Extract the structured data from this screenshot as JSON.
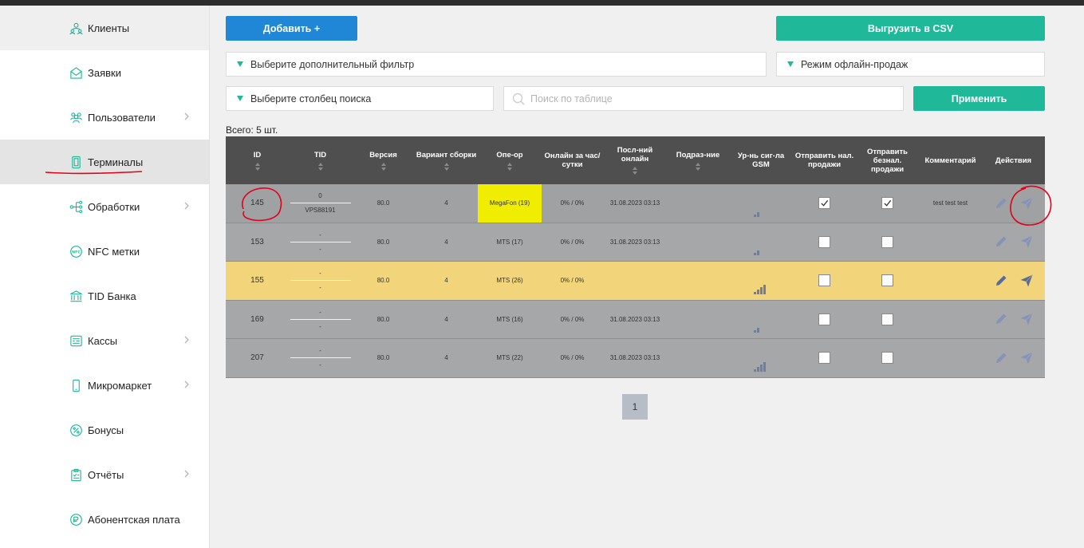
{
  "sidebar": {
    "items": [
      {
        "label": "Клиенты",
        "icon": "users-icon",
        "chevron": false
      },
      {
        "label": "Заявки",
        "icon": "envelope-icon",
        "chevron": false
      },
      {
        "label": "Пользователи",
        "icon": "team-icon",
        "chevron": true
      },
      {
        "label": "Терминалы",
        "icon": "terminal-icon",
        "chevron": false,
        "active": true
      },
      {
        "label": "Обработки",
        "icon": "network-icon",
        "chevron": true
      },
      {
        "label": "NFC метки",
        "icon": "nfc-icon",
        "chevron": false
      },
      {
        "label": "TID Банка",
        "icon": "bank-icon",
        "chevron": false
      },
      {
        "label": "Кассы",
        "icon": "cash-register-icon",
        "chevron": true
      },
      {
        "label": "Микромаркет",
        "icon": "phone-icon",
        "chevron": true
      },
      {
        "label": "Бонусы",
        "icon": "percent-icon",
        "chevron": false
      },
      {
        "label": "Отчёты",
        "icon": "clipboard-icon",
        "chevron": true
      },
      {
        "label": "Абонентская плата",
        "icon": "coins-icon",
        "chevron": false
      }
    ]
  },
  "toolbar": {
    "add_label": "Добавить +",
    "csv_label": "Выгрузить в CSV",
    "filter_placeholder": "Выберите дополнительный фильтр",
    "offline_label": "Режим офлайн-продаж",
    "column_placeholder": "Выберите столбец поиска",
    "search_placeholder": "Поиск по таблице",
    "apply_label": "Применить"
  },
  "total_label": "Всего: 5 шт.",
  "table": {
    "headers": [
      {
        "key": "id",
        "label": "ID",
        "sortable": true
      },
      {
        "key": "tid",
        "label": "TID",
        "sortable": true
      },
      {
        "key": "version",
        "label": "Версия",
        "sortable": true
      },
      {
        "key": "build",
        "label": "Вариант сборки",
        "sortable": true
      },
      {
        "key": "operator",
        "label": "Опе-ор",
        "sortable": true
      },
      {
        "key": "online",
        "label": "Онлайн за час/ сутки",
        "sortable": false
      },
      {
        "key": "last_online",
        "label": "Посл-ний онлайн",
        "sortable": true
      },
      {
        "key": "subdivision",
        "label": "Подраз-ние",
        "sortable": true
      },
      {
        "key": "gsm",
        "label": "Ур-нь сиг-ла GSM",
        "sortable": false
      },
      {
        "key": "send_cash",
        "label": "Отправить нал. продажи",
        "sortable": false
      },
      {
        "key": "send_cashless",
        "label": "Отправить безнал. продажи",
        "sortable": false
      },
      {
        "key": "comment",
        "label": "Комментарий",
        "sortable": false
      },
      {
        "key": "actions",
        "label": "Действия",
        "sortable": false
      }
    ],
    "rows": [
      {
        "id": "145",
        "tid_top": "0",
        "tid_bottom": "VPS88191",
        "version": "80.0",
        "build": "4",
        "operator": "MegaFon (19)",
        "operator_highlight": true,
        "online": "0% / 0%",
        "last_online": "31.08.2023 03:13",
        "subdivision": "",
        "gsm_level": 2,
        "send_cash": true,
        "send_cashless": true,
        "comment": "test test test",
        "highlight": false
      },
      {
        "id": "153",
        "tid_top": "-",
        "tid_bottom": "-",
        "version": "80.0",
        "build": "4",
        "operator": "MTS (17)",
        "operator_highlight": false,
        "online": "0% / 0%",
        "last_online": "31.08.2023 03:13",
        "subdivision": "",
        "gsm_level": 2,
        "send_cash": false,
        "send_cashless": false,
        "comment": "",
        "highlight": false
      },
      {
        "id": "155",
        "tid_top": "-",
        "tid_bottom": "-",
        "version": "80.0",
        "build": "4",
        "operator": "MTS (26)",
        "operator_highlight": false,
        "online": "0% / 0%",
        "last_online": "",
        "subdivision": "",
        "gsm_level": 4,
        "send_cash": false,
        "send_cashless": false,
        "comment": "",
        "highlight": true
      },
      {
        "id": "169",
        "tid_top": "-",
        "tid_bottom": "-",
        "version": "80.0",
        "build": "4",
        "operator": "MTS (16)",
        "operator_highlight": false,
        "online": "0% / 0%",
        "last_online": "31.08.2023 03:13",
        "subdivision": "",
        "gsm_level": 2,
        "send_cash": false,
        "send_cashless": false,
        "comment": "",
        "highlight": false
      },
      {
        "id": "207",
        "tid_top": "-",
        "tid_bottom": "-",
        "version": "80.0",
        "build": "4",
        "operator": "MTS (22)",
        "operator_highlight": false,
        "online": "0% / 0%",
        "last_online": "31.08.2023 03:13",
        "subdivision": "",
        "gsm_level": 4,
        "send_cash": false,
        "send_cashless": false,
        "comment": "",
        "highlight": false
      }
    ]
  },
  "pagination": {
    "current_page": "1"
  },
  "colors": {
    "primary": "#1f87d6",
    "accent": "#1fb99a",
    "header": "#4f4f4f",
    "row": "#a5a7a9",
    "highlight_row": "#f2d57a",
    "operator_highlight": "#f0ed00",
    "annotation": "#e2001a"
  }
}
